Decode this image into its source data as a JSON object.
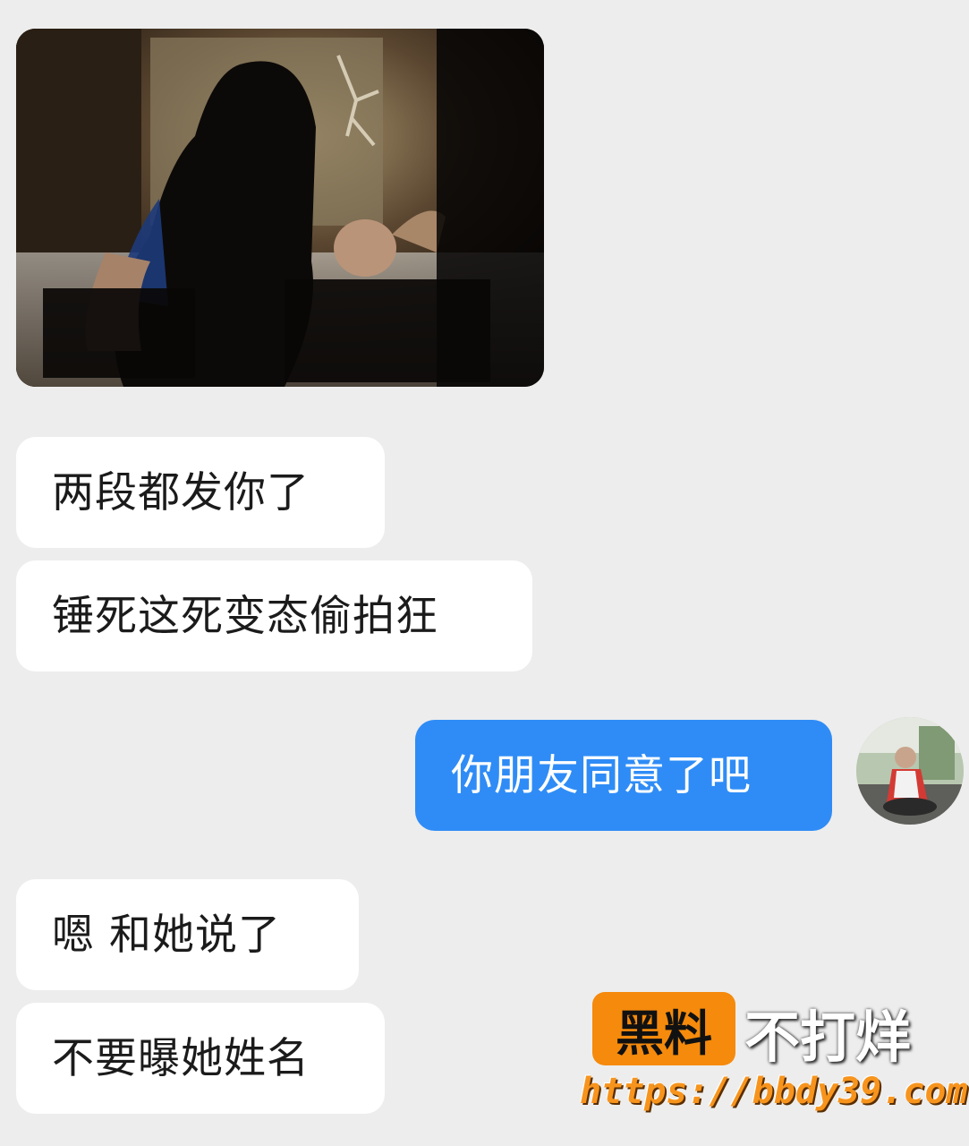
{
  "messages": [
    {
      "side": "in",
      "text": "两段都发你了"
    },
    {
      "side": "in",
      "text": "锤死这死变态偷拍狂"
    },
    {
      "side": "out",
      "text": "你朋友同意了吧"
    },
    {
      "side": "in",
      "text": "嗯 和她说了"
    },
    {
      "side": "in",
      "text": "不要曝她姓名"
    }
  ],
  "watermark": {
    "badge": "黑料",
    "tagline": "不打烊",
    "url": "https://bbdy39.com"
  },
  "colors": {
    "background": "#ededed",
    "incoming_bubble": "#ffffff",
    "outgoing_bubble": "#2f8cf6",
    "watermark_orange": "#f58a0c"
  }
}
